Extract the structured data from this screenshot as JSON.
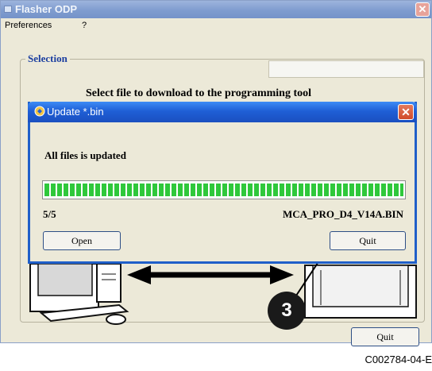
{
  "main_window": {
    "title": "Flasher ODP",
    "close_glyph": "✕",
    "menu": [
      "Preferences",
      "?"
    ],
    "selection_legend": "Selection",
    "select_file_label": "Select file to download to the programming tool",
    "quit_label": "Quit"
  },
  "dialog": {
    "title": "Update *.bin",
    "close_glyph": "✕",
    "status": "All files is updated",
    "progress": 1.0,
    "count": "5/5",
    "filename": "MCA_PRO_D4_V14A.BIN",
    "open_label": "Open",
    "quit_label": "Quit"
  },
  "callout": {
    "number": "3"
  },
  "figure_code": "C002784-04-E",
  "colors": {
    "dialog_titlebar": "#1f5fd6",
    "progress": "#2fc83b",
    "callout": "#1a1a1a"
  },
  "icons": [
    "window-icon",
    "update-icon",
    "close-icon",
    "computer-icon",
    "programming-tool-icon",
    "double-arrow-icon"
  ]
}
